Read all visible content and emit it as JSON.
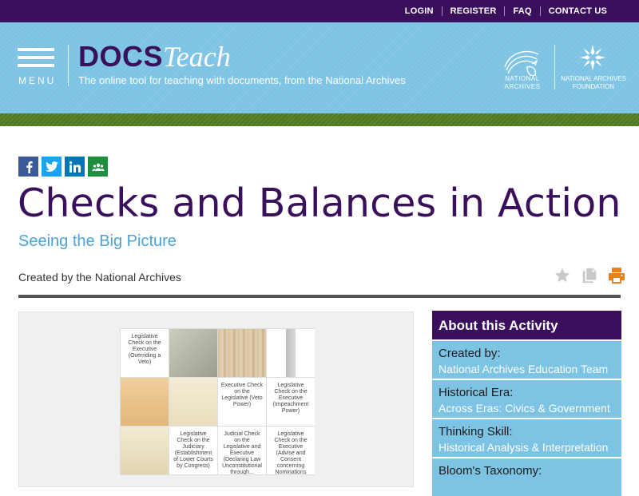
{
  "topnav": {
    "links": [
      "LOGIN",
      "REGISTER",
      "FAQ",
      "CONTACT US"
    ]
  },
  "header": {
    "menu_label": "MENU",
    "logo_docs": "DOCS",
    "logo_teach": "Teach",
    "tagline": "The online tool for teaching with documents, from the National Archives",
    "na_label_line1": "NATIONAL",
    "na_label_line2": "ARCHIVES",
    "naf_label_line1": "NATIONAL ARCHIVES",
    "naf_label_line2": "FOUNDATION"
  },
  "social": [
    "facebook-icon",
    "twitter-icon",
    "linkedin-icon",
    "google-classroom-icon"
  ],
  "page": {
    "title": "Checks and Balances in Action",
    "subtitle": "Seeing the Big Picture",
    "creator": "Created by the National Archives"
  },
  "tools": [
    "star-icon",
    "copy-icon",
    "print-icon"
  ],
  "colors": {
    "purple": "#3a0f5c",
    "blue": "#7cc3e4",
    "green": "#4f7a1f",
    "link": "#4aa3d6",
    "print": "#e8821e"
  },
  "preview": {
    "cells": [
      "Legislative Check on the Executive (Overriding a Veto)",
      "",
      "",
      "",
      "",
      "",
      "Executive Check on the Legislative (Veto Power)",
      "Legislative Check on the Executive (Impeachment Power)",
      "",
      "Legislative Check on the Judiciary (Establishment of Lower Courts by Congress)",
      "Judicial Check on the Legislative and Executive (Declaring Law Unconstitutional through...",
      "Legislative Check on the Executive (Advise and Consent concerning Nominations for..."
    ]
  },
  "sidebar": {
    "heading": "About this Activity",
    "items": [
      {
        "label": "Created by:",
        "value": "National Archives Education Team"
      },
      {
        "label": "Historical Era:",
        "value": "Across Eras: Civics & Government"
      },
      {
        "label": "Thinking Skill:",
        "value": "Historical Analysis & Interpretation"
      },
      {
        "label": "Bloom's Taxonomy:",
        "value": ""
      }
    ]
  }
}
